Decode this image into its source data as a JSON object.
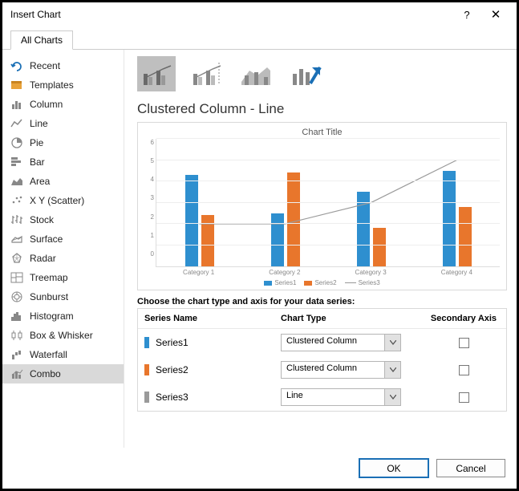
{
  "dialog": {
    "title": "Insert Chart"
  },
  "tabs": {
    "label": "All Charts"
  },
  "sidebar": {
    "items": [
      {
        "label": "Recent"
      },
      {
        "label": "Templates"
      },
      {
        "label": "Column"
      },
      {
        "label": "Line"
      },
      {
        "label": "Pie"
      },
      {
        "label": "Bar"
      },
      {
        "label": "Area"
      },
      {
        "label": "X Y (Scatter)"
      },
      {
        "label": "Stock"
      },
      {
        "label": "Surface"
      },
      {
        "label": "Radar"
      },
      {
        "label": "Treemap"
      },
      {
        "label": "Sunburst"
      },
      {
        "label": "Histogram"
      },
      {
        "label": "Box & Whisker"
      },
      {
        "label": "Waterfall"
      },
      {
        "label": "Combo"
      }
    ]
  },
  "section_title": "Clustered Column - Line",
  "choose_label": "Choose the chart type and axis for your data series:",
  "table_head": {
    "name": "Series Name",
    "type": "Chart Type",
    "axis": "Secondary Axis"
  },
  "series_rows": [
    {
      "name": "Series1",
      "type": "Clustered Column",
      "color": "#2e8fcf"
    },
    {
      "name": "Series2",
      "type": "Clustered Column",
      "color": "#e8762c"
    },
    {
      "name": "Series3",
      "type": "Line",
      "color": "#9a9a9a"
    }
  ],
  "footer": {
    "ok": "OK",
    "cancel": "Cancel"
  },
  "chart_data": {
    "type": "combo",
    "title": "Chart Title",
    "categories": [
      "Category 1",
      "Category 2",
      "Category 3",
      "Category 4"
    ],
    "ylim": [
      0,
      6
    ],
    "yticks": [
      0,
      1,
      2,
      3,
      4,
      5,
      6
    ],
    "series": [
      {
        "name": "Series1",
        "type": "bar",
        "color": "#2e8fcf",
        "values": [
          4.3,
          2.5,
          3.5,
          4.5
        ]
      },
      {
        "name": "Series2",
        "type": "bar",
        "color": "#e8762c",
        "values": [
          2.4,
          4.4,
          1.8,
          2.8
        ]
      },
      {
        "name": "Series3",
        "type": "line",
        "color": "#9a9a9a",
        "values": [
          2.0,
          2.0,
          3.0,
          5.0
        ]
      }
    ],
    "legend": [
      "Series1",
      "Series2",
      "Series3"
    ]
  }
}
